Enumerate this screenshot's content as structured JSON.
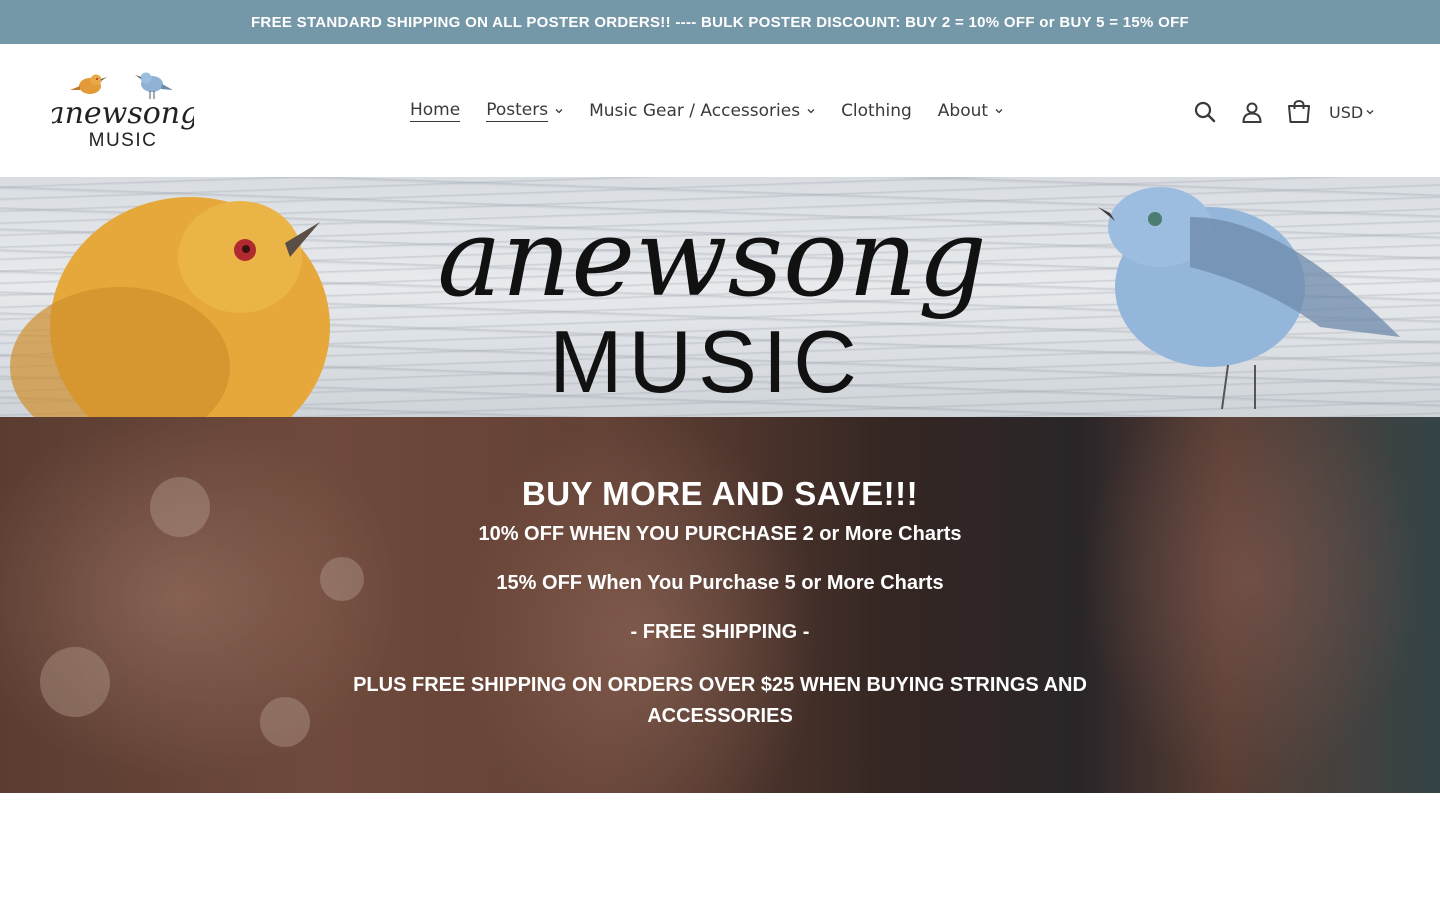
{
  "announcement": {
    "text": "FREE STANDARD SHIPPING ON ALL POSTER ORDERS!! ---- BULK POSTER DISCOUNT: BUY 2 = 10% OFF or BUY 5 = 15% OFF"
  },
  "header": {
    "logo_alt": "anewsong MUSIC",
    "nav": [
      {
        "label": "Home",
        "has_dropdown": false,
        "active": true
      },
      {
        "label": "Posters",
        "has_dropdown": true,
        "active": false
      },
      {
        "label": "Music Gear / Accessories",
        "has_dropdown": true,
        "active": false
      },
      {
        "label": "Clothing",
        "has_dropdown": false,
        "active": false
      },
      {
        "label": "About",
        "has_dropdown": true,
        "active": false
      }
    ],
    "icons": [
      "search-icon",
      "account-icon",
      "cart-icon"
    ],
    "currency": "USD"
  },
  "banner": {
    "script_text": "anewsong",
    "caps_text": "MUSIC"
  },
  "hero": {
    "title": "BUY MORE AND SAVE!!!",
    "lines": [
      "10% OFF WHEN YOU PURCHASE 2 or More Charts",
      "15% OFF When You Purchase 5 or More Charts",
      "- FREE SHIPPING -",
      "PLUS FREE SHIPPING ON ORDERS OVER $25 WHEN BUYING STRINGS AND ACCESSORIES"
    ]
  },
  "colors": {
    "announcement_bg": "#7598a9",
    "text": "#3a3a3a",
    "bird_yellow": "#e8a93a",
    "bird_blue": "#8fb2d6"
  }
}
